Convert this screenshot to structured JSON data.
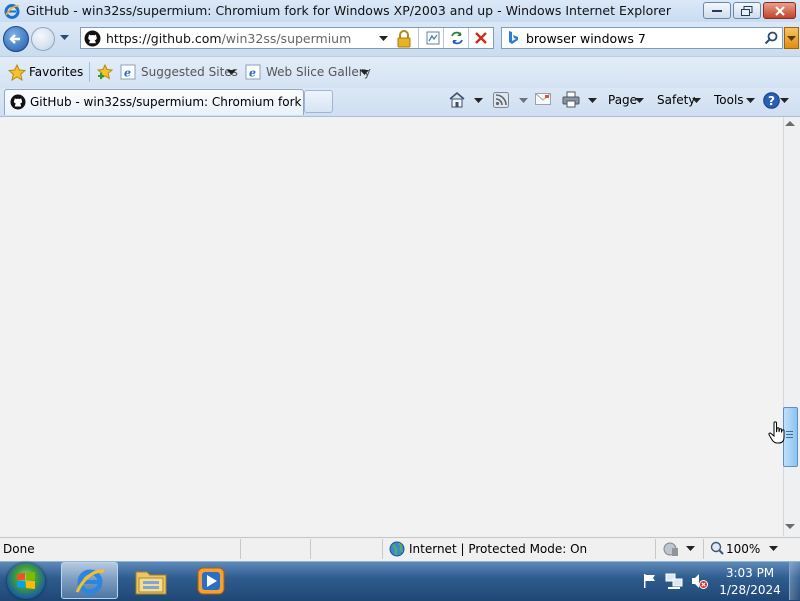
{
  "window": {
    "title": "GitHub - win32ss/supermium: Chromium fork for Windows XP/2003 and up - Windows Internet Explorer"
  },
  "address_bar": {
    "url_host": "https://github.com",
    "url_path": "/win32ss/supermium"
  },
  "search": {
    "value": "browser windows 7"
  },
  "favorites_bar": {
    "favorites_label": "Favorites",
    "items": [
      {
        "label": "Suggested Sites"
      },
      {
        "label": "Web Slice Gallery"
      }
    ]
  },
  "tabs": [
    {
      "label": "GitHub - win32ss/supermium: Chromium fork fo...",
      "active": true
    }
  ],
  "command_bar": {
    "page": "Page",
    "safety": "Safety",
    "tools": "Tools"
  },
  "status_bar": {
    "status": "Done",
    "zone": "Internet | Protected Mode: On",
    "zoom": "100%"
  },
  "taskbar": {
    "time": "3:03 PM",
    "date": "1/28/2024"
  },
  "colors": {
    "content_bg": "#f2f2f2",
    "accent": "#1e5aa8"
  },
  "icons": [
    "ie-icon",
    "github-icon",
    "lock-icon",
    "compat-view-icon",
    "refresh-icon",
    "stop-icon",
    "bing-icon",
    "search-icon",
    "favorites-star-icon",
    "add-favorite-icon",
    "home-icon",
    "feeds-icon",
    "mail-icon",
    "print-icon",
    "help-icon",
    "globe-icon",
    "protected-mode-icon",
    "zoom-icon",
    "windows-orb-icon",
    "explorer-icon",
    "media-player-icon",
    "flag-icon",
    "network-icon",
    "volume-muted-icon",
    "hand-cursor-icon"
  ]
}
